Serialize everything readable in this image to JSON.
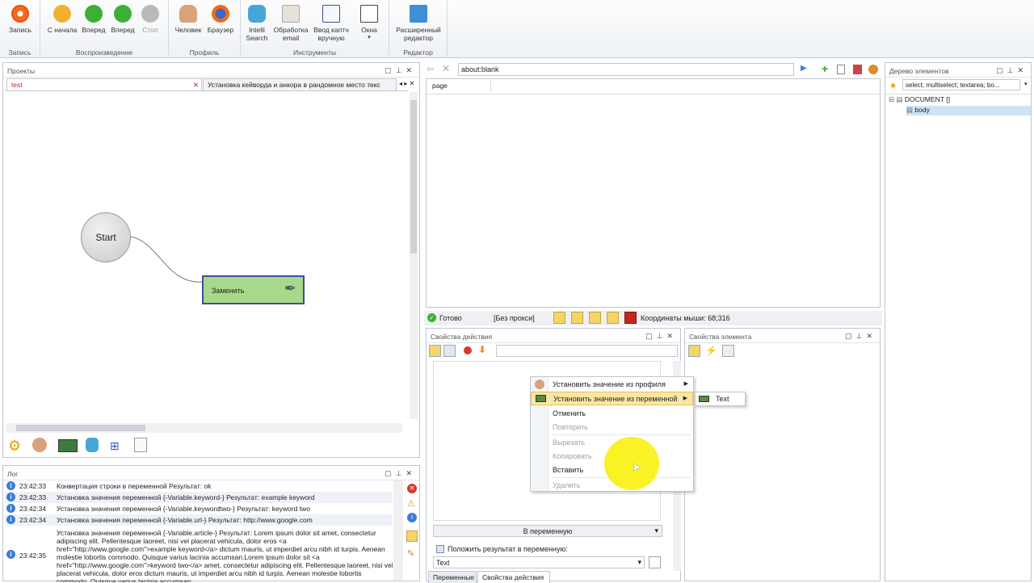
{
  "ribbon": {
    "record": {
      "label": "Запись",
      "group": "Запись"
    },
    "playback": {
      "group": "Воспроизведение",
      "buttons": [
        {
          "label": "С начала",
          "icon": "restart-icon",
          "color": "#f0b030"
        },
        {
          "label": "Вперед",
          "icon": "play-icon",
          "color": "#3cb034"
        },
        {
          "label": "Вперед",
          "icon": "play-step-icon",
          "color": "#3cb034"
        },
        {
          "label": "Стоп",
          "icon": "stop-icon",
          "color": "#b9b9b9"
        }
      ]
    },
    "profile": {
      "group": "Профиль",
      "buttons": [
        {
          "label": "Человек",
          "icon": "person-icon"
        },
        {
          "label": "Браузер",
          "icon": "firefox-icon"
        }
      ]
    },
    "tools": {
      "group": "Инструменты",
      "buttons": [
        {
          "label": "Intelli Search",
          "icon": "robot-icon"
        },
        {
          "label": "Обработка email",
          "icon": "email-icon"
        },
        {
          "label": "Ввод каптч вручную",
          "icon": "captcha-icon"
        },
        {
          "label": "Окна",
          "icon": "windows-icon"
        }
      ]
    },
    "editor": {
      "group": "Редактор",
      "buttons": [
        {
          "label": "Расширенный редактор",
          "icon": "expand-icon"
        }
      ]
    }
  },
  "projects": {
    "title": "Проекты",
    "tabs": [
      "test",
      "Установка кейворда и анкора в рандомное место текс"
    ],
    "start_label": "Start",
    "node_label": "Заменить"
  },
  "browser": {
    "url": "about:blank",
    "tab": "page",
    "status": "Готово",
    "proxy": "[Без прокси]",
    "mouse": "Координаты мыши: 68;316"
  },
  "tree": {
    "title": "Дерево элементов",
    "selector": "select; multiselect; textarea; bo...",
    "nodes": [
      "DOCUMENT []",
      "body"
    ]
  },
  "action_props": {
    "title": "Свойства действия",
    "dropdown": "В переменную",
    "checkbox": "Положить результат в переменную:",
    "result": "Text",
    "bottom_tabs": [
      "Переменные",
      "Свойства действия"
    ]
  },
  "element_props": {
    "title": "Свойства элемента"
  },
  "context_menu": {
    "items": [
      {
        "label": "Установить значение из профиля",
        "disabled": false
      },
      {
        "label": "Установить значение из переменной",
        "disabled": false
      },
      {
        "label": "Отменить",
        "disabled": false
      },
      {
        "label": "Повторить",
        "disabled": true
      },
      {
        "label": "Вырезать",
        "disabled": true
      },
      {
        "label": "Копировать",
        "disabled": true
      },
      {
        "label": "Вставить",
        "disabled": false
      },
      {
        "label": "Удалить",
        "disabled": true
      }
    ],
    "submenu": [
      "Text"
    ]
  },
  "log": {
    "title": "Лог",
    "rows": [
      {
        "time": "23:42:33",
        "msg": "Конвертация строки в переменной  Результат: ok"
      },
      {
        "time": "23:42:33",
        "msg": "Установка значения переменной {-Variable.keyword-}  Результат: example keyword"
      },
      {
        "time": "23:42:34",
        "msg": "Установка значения переменной {-Variable.keywordtwo-}  Результат: keyword two"
      },
      {
        "time": "23:42:34",
        "msg": "Установка значения переменной {-Variable.url-}  Результат: http://www.google.com"
      },
      {
        "time": "23:42:35",
        "msg": "Установка значения переменной {-Variable.article-}  Результат: Lorem ipsum dolor sit amet, consectetur adipiscing elit. Pellentesque laoreet, nisi vel placerat vehicula, dolor eros <a href=\"http://www.google.com\">example keyword</a> dictum mauris, ut imperdiet arcu nibh id turpis. Aenean molestie lobortis commodo. Quisque varius lacinia accumsan.Lorem ipsum dolor sit <a href=\"http://www.google.com\">keyword two</a> amet, consectetur adipiscing elit. Pellentesque laoreet, nisi vel placerat vehicula, dolor eros dictum mauris, ut imperdiet arcu nibh id turpis. Aenean molestie lobortis commodo. Quisque varius lacinia accumsan."
      }
    ]
  }
}
